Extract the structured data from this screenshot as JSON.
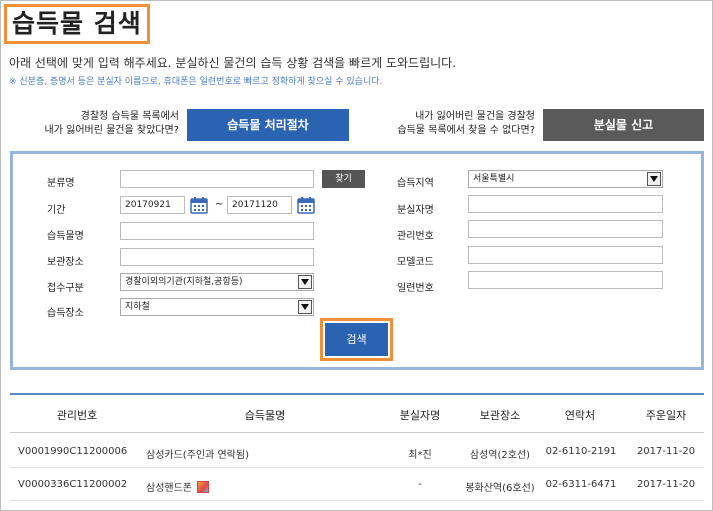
{
  "header": {
    "title": "습득물 검색",
    "description": "아래 선택에 맞게 입력 해주세요. 분실하신 물건의 습득 상황 검색을 빠르게 도와드립니다.",
    "note": "※ 신분증, 증명서 등은 분실자 이름으로, 휴대폰은 일련번호로 빠르고 정확하게 찾으실 수 있습니다."
  },
  "guide": {
    "left_text_line1": "경찰청 습득물 목록에서",
    "left_text_line2": "내가 잃어버린 물건을 찾았다면?",
    "left_button": "습득물 처리절차",
    "right_text_line1": "내가 잃어버린 물건을 경찰청",
    "right_text_line2": "습득물 목록에서 찾을 수 없다면?",
    "right_button": "분실물 신고"
  },
  "form": {
    "category_label": "분류명",
    "category_value": "",
    "find_button": "찾기",
    "period_label": "기간",
    "period_from": "20170921",
    "period_tilde": "~",
    "period_to": "20171120",
    "item_name_label": "습득물명",
    "item_name_value": "",
    "storage_label": "보관장소",
    "storage_value": "",
    "intake_label": "접수구분",
    "intake_value": "경찰이외의기관(지하철,공항등)",
    "found_place_label": "습득장소",
    "found_place_value": "지하철",
    "region_label": "습득지역",
    "region_value": "서울특별시",
    "loser_name_label": "분실자명",
    "loser_name_value": "",
    "manage_no_label": "관리번호",
    "manage_no_value": "",
    "model_code_label": "모델코드",
    "model_code_value": "",
    "serial_no_label": "일련번호",
    "serial_no_value": "",
    "search_button": "검색"
  },
  "table": {
    "headers": [
      "관리번호",
      "습득물명",
      "분실자명",
      "보관장소",
      "연락처",
      "주운일자"
    ],
    "rows": [
      [
        "V0001990C11200006",
        "삼성카드(주인과 연락됨)",
        "최*진",
        "삼성역(2호선)",
        "02-6110-2191",
        "2017-11-20"
      ],
      [
        "V0000336C11200002",
        "삼성핸드폰",
        "-",
        "봉화산역(6호선)",
        "02-6311-6471",
        "2017-11-20"
      ]
    ]
  },
  "colors": {
    "accent_blue": "#2b63b3",
    "highlight_orange": "#f0913a",
    "panel_border": "#97b6dc",
    "dark_button": "#5a5a5a"
  }
}
